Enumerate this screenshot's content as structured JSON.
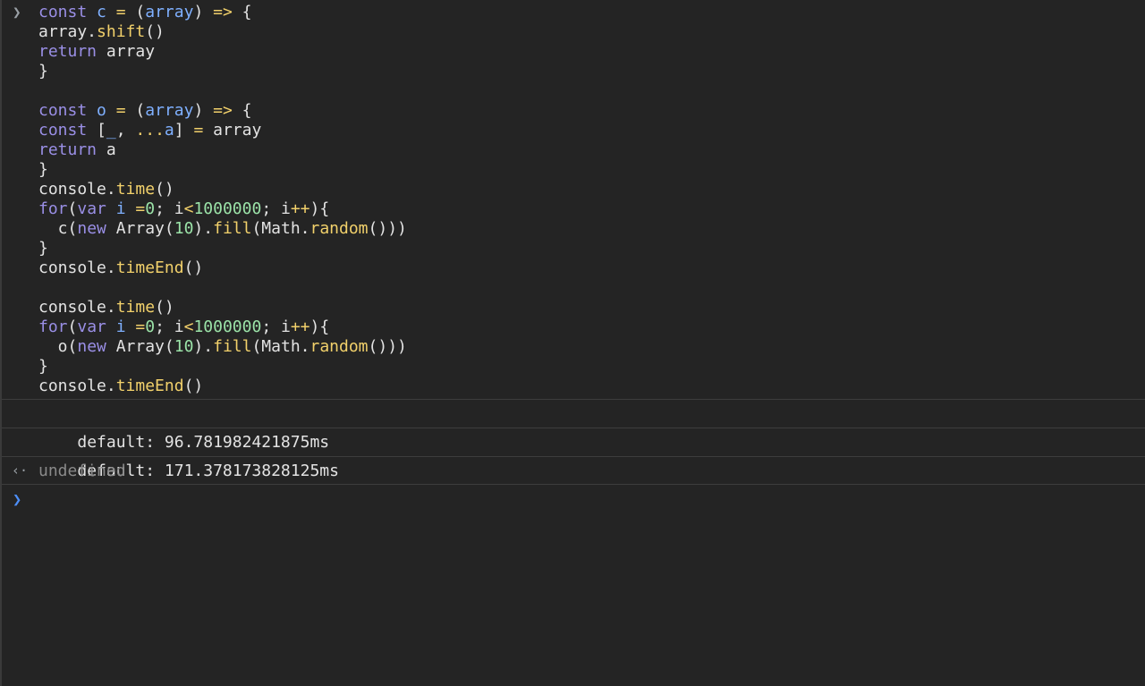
{
  "console": {
    "input_lines": [
      [
        {
          "t": "const",
          "c": "kw"
        },
        {
          "t": " ",
          "c": "plain"
        },
        {
          "t": "c",
          "c": "var"
        },
        {
          "t": " ",
          "c": "plain"
        },
        {
          "t": "=",
          "c": "op"
        },
        {
          "t": " (",
          "c": "plain"
        },
        {
          "t": "array",
          "c": "var"
        },
        {
          "t": ") ",
          "c": "plain"
        },
        {
          "t": "=>",
          "c": "op"
        },
        {
          "t": " {",
          "c": "plain"
        }
      ],
      [
        {
          "t": "array.",
          "c": "plain"
        },
        {
          "t": "shift",
          "c": "fn"
        },
        {
          "t": "()",
          "c": "plain"
        }
      ],
      [
        {
          "t": "return",
          "c": "kw"
        },
        {
          "t": " array",
          "c": "plain"
        }
      ],
      [
        {
          "t": "}",
          "c": "plain"
        }
      ],
      [],
      [
        {
          "t": "const",
          "c": "kw"
        },
        {
          "t": " ",
          "c": "plain"
        },
        {
          "t": "o",
          "c": "var"
        },
        {
          "t": " ",
          "c": "plain"
        },
        {
          "t": "=",
          "c": "op"
        },
        {
          "t": " (",
          "c": "plain"
        },
        {
          "t": "array",
          "c": "var"
        },
        {
          "t": ") ",
          "c": "plain"
        },
        {
          "t": "=>",
          "c": "op"
        },
        {
          "t": " {",
          "c": "plain"
        }
      ],
      [
        {
          "t": "const",
          "c": "kw"
        },
        {
          "t": " [",
          "c": "plain"
        },
        {
          "t": "_",
          "c": "var"
        },
        {
          "t": ", ",
          "c": "plain"
        },
        {
          "t": "...",
          "c": "op"
        },
        {
          "t": "a",
          "c": "var"
        },
        {
          "t": "] ",
          "c": "plain"
        },
        {
          "t": "=",
          "c": "op"
        },
        {
          "t": " array",
          "c": "plain"
        }
      ],
      [
        {
          "t": "return",
          "c": "kw"
        },
        {
          "t": " a",
          "c": "plain"
        }
      ],
      [
        {
          "t": "}",
          "c": "plain"
        }
      ],
      [
        {
          "t": "console.",
          "c": "plain"
        },
        {
          "t": "time",
          "c": "fn"
        },
        {
          "t": "()",
          "c": "plain"
        }
      ],
      [
        {
          "t": "for",
          "c": "kw"
        },
        {
          "t": "(",
          "c": "plain"
        },
        {
          "t": "var",
          "c": "kw"
        },
        {
          "t": " ",
          "c": "plain"
        },
        {
          "t": "i",
          "c": "var"
        },
        {
          "t": " ",
          "c": "plain"
        },
        {
          "t": "=",
          "c": "op"
        },
        {
          "t": "0",
          "c": "num"
        },
        {
          "t": "; i",
          "c": "plain"
        },
        {
          "t": "<",
          "c": "op"
        },
        {
          "t": "1000000",
          "c": "num"
        },
        {
          "t": "; i",
          "c": "plain"
        },
        {
          "t": "++",
          "c": "op"
        },
        {
          "t": "){",
          "c": "plain"
        }
      ],
      [
        {
          "t": "  c(",
          "c": "plain"
        },
        {
          "t": "new",
          "c": "kw"
        },
        {
          "t": " Array(",
          "c": "plain"
        },
        {
          "t": "10",
          "c": "num"
        },
        {
          "t": ").",
          "c": "plain"
        },
        {
          "t": "fill",
          "c": "fn"
        },
        {
          "t": "(Math.",
          "c": "plain"
        },
        {
          "t": "random",
          "c": "fn"
        },
        {
          "t": "()))",
          "c": "plain"
        }
      ],
      [
        {
          "t": "}",
          "c": "plain"
        }
      ],
      [
        {
          "t": "console.",
          "c": "plain"
        },
        {
          "t": "timeEnd",
          "c": "fn"
        },
        {
          "t": "()",
          "c": "plain"
        }
      ],
      [],
      [
        {
          "t": "console.",
          "c": "plain"
        },
        {
          "t": "time",
          "c": "fn"
        },
        {
          "t": "()",
          "c": "plain"
        }
      ],
      [
        {
          "t": "for",
          "c": "kw"
        },
        {
          "t": "(",
          "c": "plain"
        },
        {
          "t": "var",
          "c": "kw"
        },
        {
          "t": " ",
          "c": "plain"
        },
        {
          "t": "i",
          "c": "var"
        },
        {
          "t": " ",
          "c": "plain"
        },
        {
          "t": "=",
          "c": "op"
        },
        {
          "t": "0",
          "c": "num"
        },
        {
          "t": "; i",
          "c": "plain"
        },
        {
          "t": "<",
          "c": "op"
        },
        {
          "t": "1000000",
          "c": "num"
        },
        {
          "t": "; i",
          "c": "plain"
        },
        {
          "t": "++",
          "c": "op"
        },
        {
          "t": "){",
          "c": "plain"
        }
      ],
      [
        {
          "t": "  o(",
          "c": "plain"
        },
        {
          "t": "new",
          "c": "kw"
        },
        {
          "t": " Array(",
          "c": "plain"
        },
        {
          "t": "10",
          "c": "num"
        },
        {
          "t": ").",
          "c": "plain"
        },
        {
          "t": "fill",
          "c": "fn"
        },
        {
          "t": "(Math.",
          "c": "plain"
        },
        {
          "t": "random",
          "c": "fn"
        },
        {
          "t": "()))",
          "c": "plain"
        }
      ],
      [
        {
          "t": "}",
          "c": "plain"
        }
      ],
      [
        {
          "t": "console.",
          "c": "plain"
        },
        {
          "t": "timeEnd",
          "c": "fn"
        },
        {
          "t": "()",
          "c": "plain"
        }
      ]
    ],
    "logs": [
      {
        "text": "default: 96.781982421875ms"
      },
      {
        "text": "default: 171.378173828125ms"
      }
    ],
    "result": {
      "text": "undefined"
    },
    "prompt_value": "",
    "icons": {
      "input_prompt": "chevron-right-icon",
      "result_arrow": "result-arrow-icon",
      "active_prompt": "chevron-right-icon"
    },
    "colors": {
      "background": "#242424",
      "keyword": "#9a8fe6",
      "variable": "#7fb0ff",
      "function": "#f2d16b",
      "number": "#9be3a8",
      "text": "#e3e3e3",
      "muted": "#8a8a8a",
      "active_prompt": "#4d8ef7"
    }
  }
}
